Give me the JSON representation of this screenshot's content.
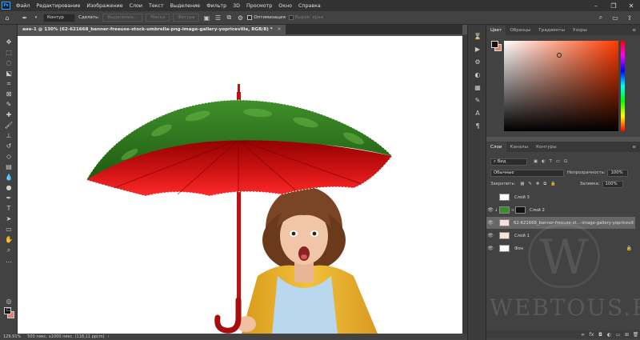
{
  "menubar": {
    "app_logo": "Ps",
    "items": [
      "Файл",
      "Редактирование",
      "Изображение",
      "Слои",
      "Текст",
      "Выделение",
      "Фильтр",
      "3D",
      "Просмотр",
      "Окно",
      "Справка"
    ]
  },
  "options": {
    "mode_value": "Контур",
    "make_label": "Сделать:",
    "selection_btn": "Выделение...",
    "mask_btn": "Маска",
    "shape_btn": "Фигура",
    "optimize_label": "Оптимизация",
    "align_edges_label": "Выров. края"
  },
  "document": {
    "tab_title": "анн-1 @ 130% (62-621668_banner-freeuse-stock-umbrella-png-image-gallery-yopriceville, RGB/8) *"
  },
  "statusbar": {
    "zoom": "129,91%",
    "info": "500 пикс. x1000 пикс. (118,11 ppcm)"
  },
  "color_panel": {
    "tabs": [
      "Цвет",
      "Образцы",
      "Градиенты",
      "Узоры"
    ],
    "active_tab": "Цвет",
    "fg_color": "#1a0f0c",
    "bg_color": "#e07d6b"
  },
  "layers_panel": {
    "tabs": [
      "Слои",
      "Каналы",
      "Контуры"
    ],
    "active_tab": "Слои",
    "filter_value": "Вид",
    "blend_value": "Обычные",
    "opacity_label": "Непрозрачность:",
    "opacity_value": "100%",
    "lock_label": "Закрепить:",
    "fill_label": "Заливка:",
    "fill_value": "100%",
    "layers": [
      {
        "name": "Слой 3",
        "visible": false,
        "selected": false
      },
      {
        "name": "Слой 2",
        "visible": true,
        "selected": false
      },
      {
        "name": "62-621668_banner-freeuse-st...-image-gallery-yopriceville",
        "visible": true,
        "selected": true
      },
      {
        "name": "Слой 1",
        "visible": true,
        "selected": false
      },
      {
        "name": "Фон",
        "visible": true,
        "selected": false
      }
    ]
  },
  "watermark": {
    "text": "WEBTOUS.RU",
    "letter": "W"
  }
}
